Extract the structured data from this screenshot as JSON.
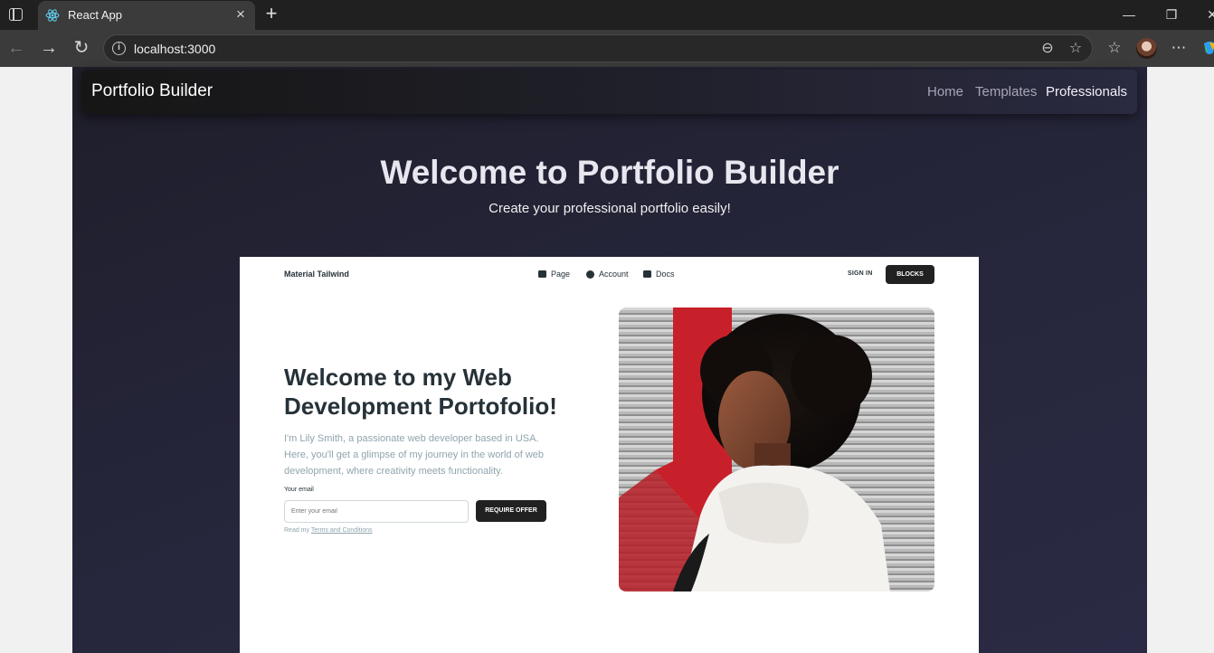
{
  "browser": {
    "tab_title": "React App",
    "url": "localhost:3000"
  },
  "navbar": {
    "brand": "Portfolio Builder",
    "links": [
      "Home",
      "Templates",
      "Professionals"
    ],
    "active_link": "Professionals"
  },
  "hero": {
    "title": "Welcome to Portfolio Builder",
    "subtitle": "Create your professional portfolio easily!"
  },
  "preview": {
    "brand": "Material Tailwind",
    "nav": {
      "page": "Page",
      "account": "Account",
      "docs": "Docs"
    },
    "sign_in": "SIGN IN",
    "blocks": "BLOCKS",
    "heading": "Welcome to my Web Development Portofolio!",
    "paragraph": "I'm Lily Smith, a passionate web developer based in USA. Here, you'll get a glimpse of my journey in the world of web development, where creativity meets functionality.",
    "email_label": "Your email",
    "email_placeholder": "Enter your email",
    "require_button": "REQUIRE OFFER",
    "terms_prefix": "Read my",
    "terms_link": "Terms and Conditions"
  },
  "colors": {
    "app_bg": "#25253a",
    "preview_heading": "#263238",
    "preview_muted": "#90a4ae",
    "button_dark": "#212121"
  }
}
